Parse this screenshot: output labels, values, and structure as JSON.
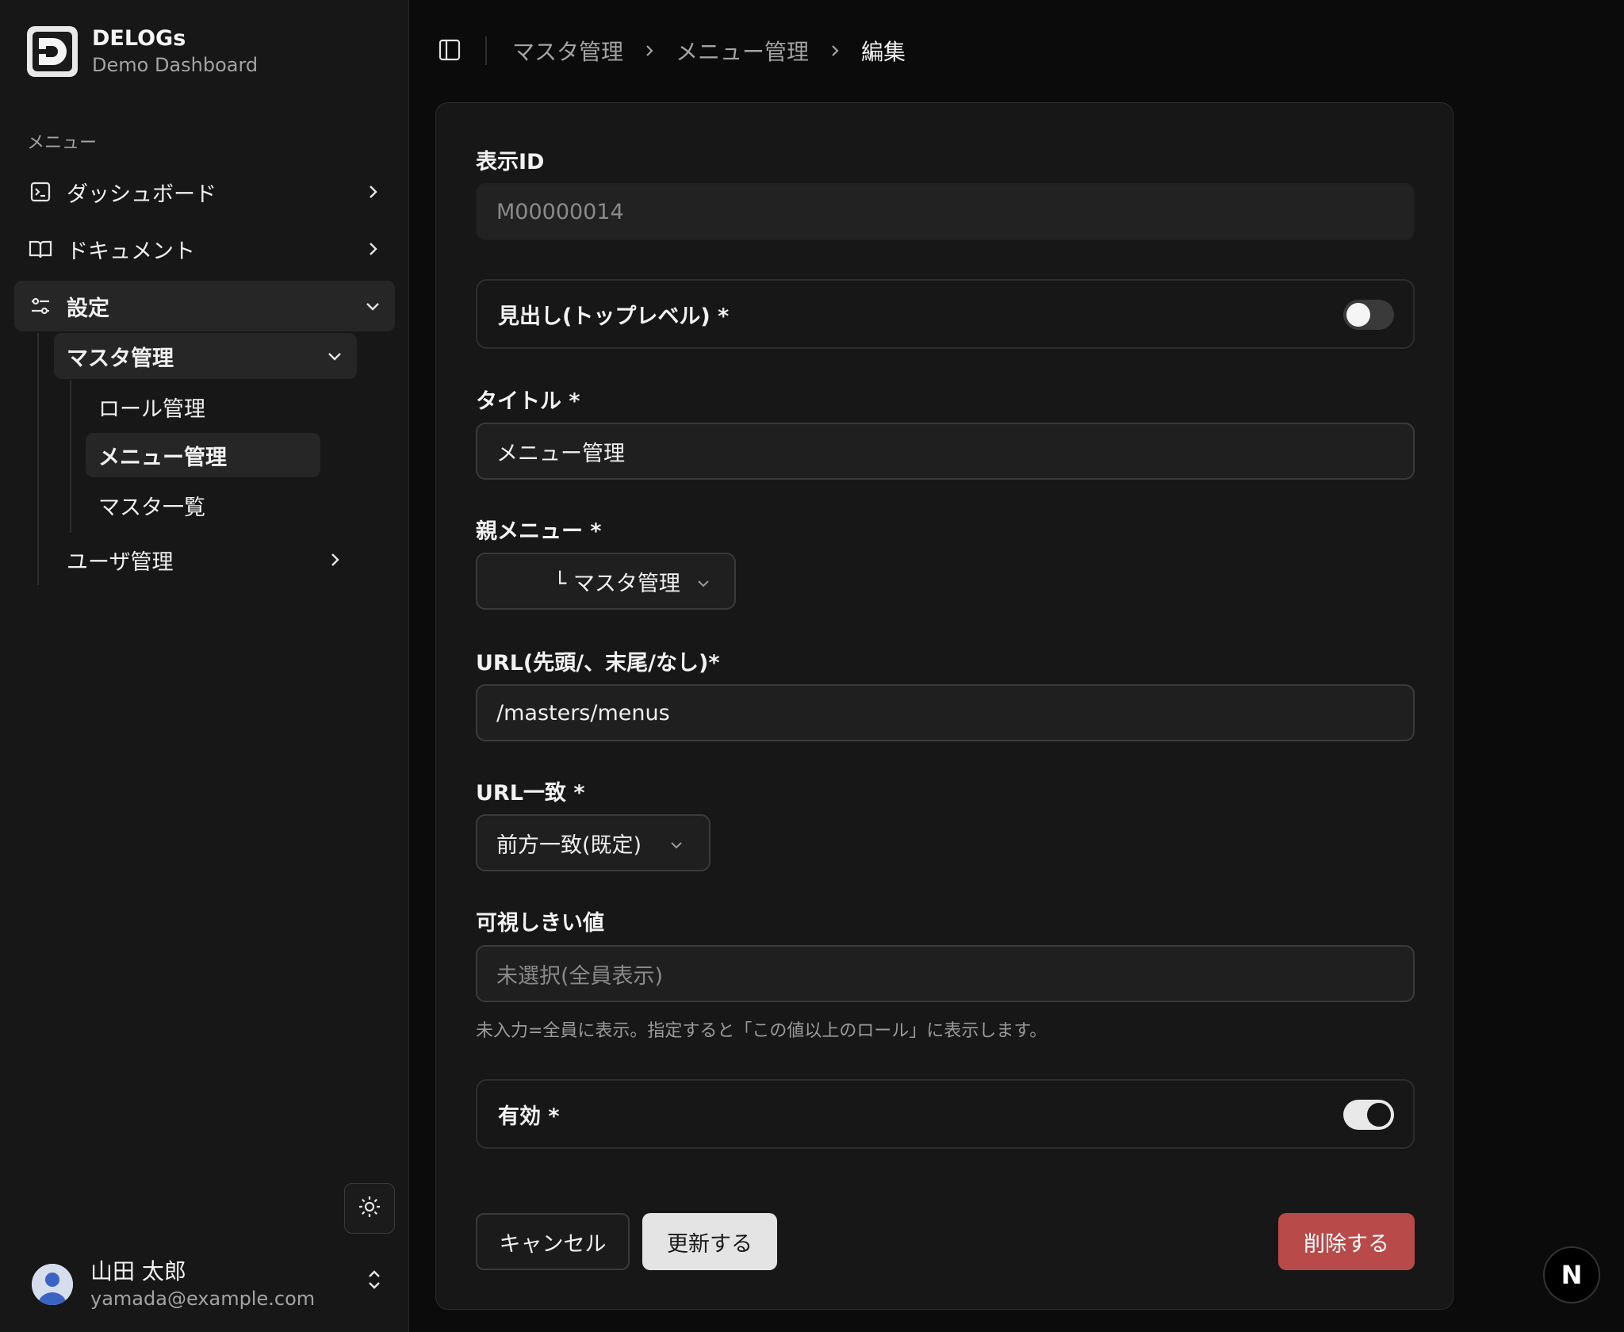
{
  "brand": {
    "title": "DELOGs",
    "subtitle": "Demo Dashboard"
  },
  "sidebar": {
    "section_label": "メニュー",
    "items": [
      {
        "label": "ダッシュボード",
        "icon": "terminal-square-icon"
      },
      {
        "label": "ドキュメント",
        "icon": "book-open-icon"
      },
      {
        "label": "設定",
        "icon": "sliders-icon"
      }
    ],
    "settings_children": {
      "group": "マスタ管理",
      "group_items": [
        "ロール管理",
        "メニュー管理",
        "マスタ一覧"
      ],
      "user_mgmt": "ユーザ管理"
    }
  },
  "user": {
    "name": "山田 太郎",
    "email": "yamada@example.com"
  },
  "breadcrumb": {
    "items": [
      "マスタ管理",
      "メニュー管理"
    ],
    "current": "編集"
  },
  "form": {
    "display_id": {
      "label": "表示ID",
      "value": "M00000014"
    },
    "heading_toplevel": {
      "label": "見出し(トップレベル) *",
      "on": false
    },
    "title": {
      "label": "タイトル *",
      "value": "メニュー管理"
    },
    "parent_menu": {
      "label": "親メニュー *",
      "value": "└ マスタ管理"
    },
    "url": {
      "label": "URL(先頭/、末尾/なし)*",
      "value": "/masters/menus"
    },
    "url_match": {
      "label": "URL一致 *",
      "value": "前方一致(既定)"
    },
    "visibility": {
      "label": "可視しきい値",
      "placeholder": "未選択(全員表示)",
      "hint": "未入力=全員に表示。指定すると「この値以上のロール」に表示します。"
    },
    "enabled": {
      "label": "有効 *",
      "on": true
    },
    "buttons": {
      "cancel": "キャンセル",
      "update": "更新する",
      "delete": "削除する"
    }
  },
  "corner_badge": "N",
  "colors": {
    "danger": "#b94a4a",
    "surface": "#171717",
    "background": "#0b0b0b"
  }
}
